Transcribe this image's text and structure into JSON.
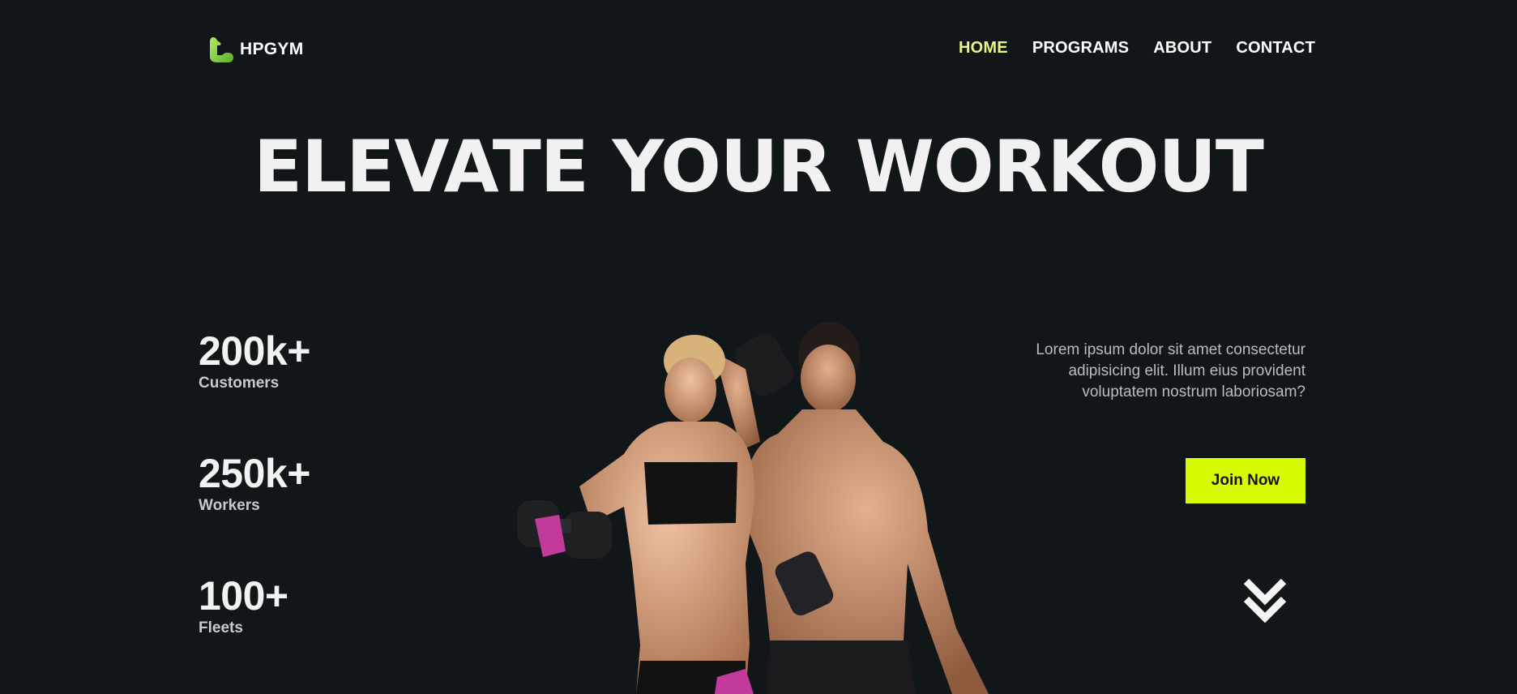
{
  "brand": {
    "name": "HPGYM",
    "logo_icon": "flexed-bicep-icon",
    "logo_color": "#8fd14f"
  },
  "nav": {
    "items": [
      {
        "label": "HOME",
        "active": true
      },
      {
        "label": "PROGRAMS",
        "active": false
      },
      {
        "label": "ABOUT",
        "active": false
      },
      {
        "label": "CONTACT",
        "active": false
      }
    ],
    "active_color": "#e9f58a"
  },
  "hero": {
    "title": "ELEVATE YOUR WORKOUT",
    "description": "Lorem ipsum dolor sit amet consectetur adipisicing elit. Illum eius provident voluptatem nostrum laboriosam?",
    "cta_label": "Join Now",
    "cta_color": "#d7fb00",
    "image": "two-athletes-with-dumbbells"
  },
  "stats": [
    {
      "value": "200k+",
      "label": "Customers"
    },
    {
      "value": "250k+",
      "label": "Workers"
    },
    {
      "value": "100+",
      "label": "Fleets"
    }
  ],
  "scroll_indicator": {
    "icon": "double-chevron-down-icon"
  },
  "colors": {
    "background": "#111719",
    "text": "#f1f1f1"
  }
}
